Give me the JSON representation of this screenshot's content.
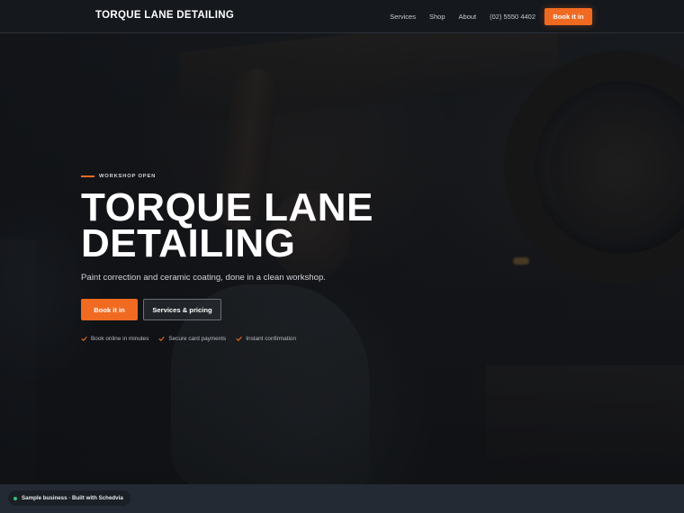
{
  "nav": {
    "brand": "TORQUE LANE DETAILING",
    "links": [
      "Services",
      "Shop",
      "About"
    ],
    "phone": "(02) 5550 4402",
    "book_label": "Book it in"
  },
  "hero": {
    "eyebrow": "WORKSHOP OPEN",
    "title_line1": "TORQUE LANE",
    "title_line2": "DETAILING",
    "subtitle": "Paint correction and ceramic coating, done in a clean workshop.",
    "primary_cta": "Book it in",
    "secondary_cta": "Services & pricing",
    "features": [
      "Book online in minutes",
      "Secure card payments",
      "Instant confirmation"
    ]
  },
  "badge": {
    "text": "Sample business · Built with Schedvia"
  },
  "colors": {
    "accent": "#f06a21",
    "check": "#f06a21",
    "status_dot": "#34c17a"
  }
}
